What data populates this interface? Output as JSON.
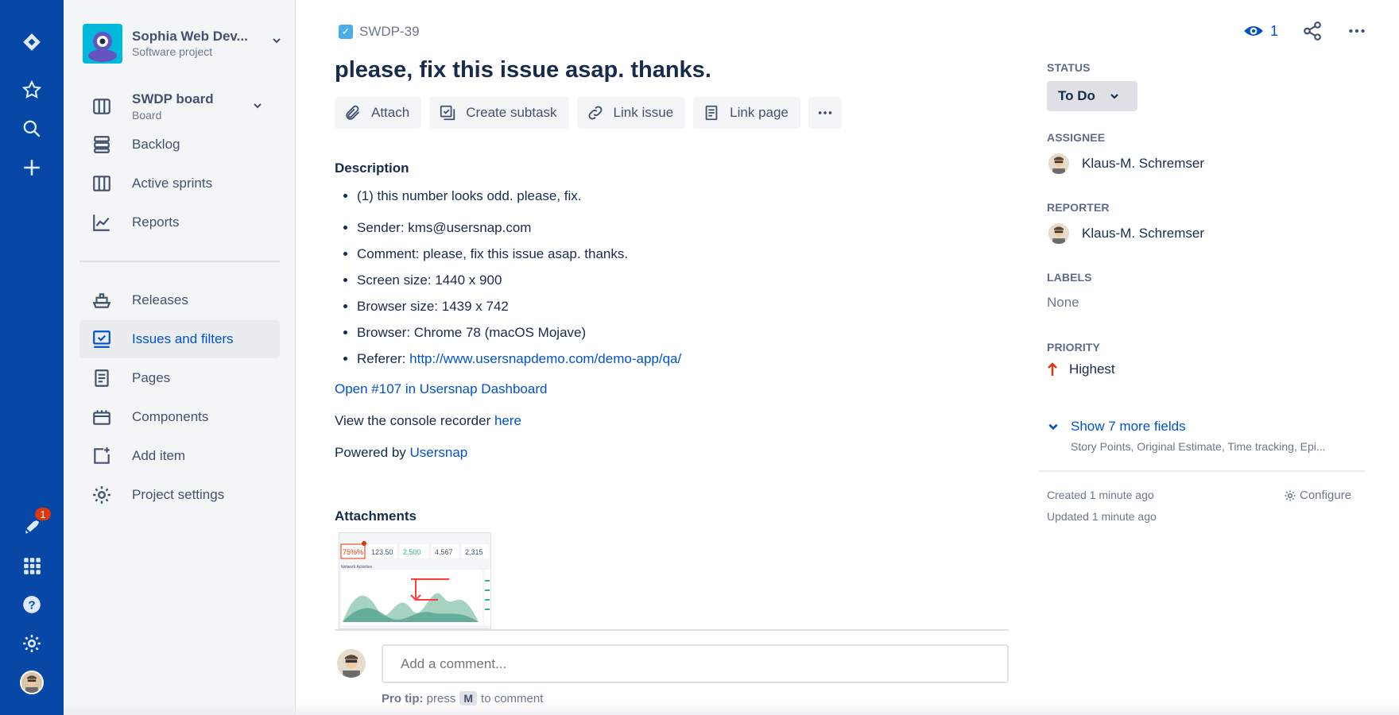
{
  "global_nav": {
    "notification_count": "1",
    "icons": [
      "jira-logo-icon",
      "star-icon",
      "search-icon",
      "plus-icon",
      "notification-icon",
      "apps-grid-icon",
      "help-icon",
      "settings-icon",
      "avatar"
    ]
  },
  "sidebar": {
    "project_name": "Sophia Web Dev...",
    "project_type": "Software project",
    "board": {
      "label": "SWDP board",
      "sub": "Board"
    },
    "items_top": [
      {
        "label": "Backlog",
        "icon": "backlog-icon"
      },
      {
        "label": "Active sprints",
        "icon": "sprints-icon"
      },
      {
        "label": "Reports",
        "icon": "reports-icon"
      }
    ],
    "items_bottom": [
      {
        "label": "Releases",
        "icon": "releases-icon"
      },
      {
        "label": "Issues and filters",
        "icon": "issues-icon",
        "active": true
      },
      {
        "label": "Pages",
        "icon": "pages-icon"
      },
      {
        "label": "Components",
        "icon": "components-icon"
      },
      {
        "label": "Add item",
        "icon": "add-item-icon"
      },
      {
        "label": "Project settings",
        "icon": "gear-icon"
      }
    ]
  },
  "issue": {
    "key": "SWDP-39",
    "title": "please, fix this issue asap. thanks.",
    "toolbar": {
      "attach": "Attach",
      "create_subtask": "Create subtask",
      "link_issue": "Link issue",
      "link_page": "Link page"
    },
    "description": {
      "heading": "Description",
      "items": [
        "(1) this number looks odd. please, fix.",
        "Sender: kms@usersnap.com",
        "Comment: please, fix this issue asap. thanks.",
        "Screen size: 1440 x 900",
        "Browser size: 1439 x 742",
        "Browser: Chrome 78 (macOS Mojave)"
      ],
      "referer_label": "Referer: ",
      "referer_url": "http://www.usersnapdemo.com/demo-app/qa/",
      "open_link": "Open #107 in Usersnap Dashboard",
      "console_text": "View the console recorder ",
      "console_link": "here",
      "powered_text": "Powered by ",
      "powered_link": "Usersnap"
    },
    "attachments_heading": "Attachments",
    "attachment_thumb": {
      "values": [
        "75%%",
        "123.50",
        "2,500",
        "4,567",
        "2,315"
      ],
      "chart_title": "Network Activities"
    },
    "comment": {
      "placeholder": "Add a comment...",
      "protip_prefix": "Pro tip:",
      "protip_press": "press",
      "protip_key": "M",
      "protip_suffix": "to comment"
    }
  },
  "details": {
    "watch_count": "1",
    "status_label": "STATUS",
    "status_value": "To Do",
    "assignee_label": "ASSIGNEE",
    "assignee": "Klaus-M. Schremser",
    "reporter_label": "REPORTER",
    "reporter": "Klaus-M. Schremser",
    "labels_label": "LABELS",
    "labels_value": "None",
    "priority_label": "PRIORITY",
    "priority_value": "Highest",
    "show_more": "Show 7 more fields",
    "show_more_sub": "Story Points, Original Estimate, Time tracking, Epi...",
    "created": "Created 1 minute ago",
    "updated": "Updated 1 minute ago",
    "configure": "Configure"
  },
  "colors": {
    "global_nav": "#0747a6",
    "link": "#0052cc",
    "priority_highest": "#de350b",
    "sidebar_bg": "#f4f5f7"
  }
}
